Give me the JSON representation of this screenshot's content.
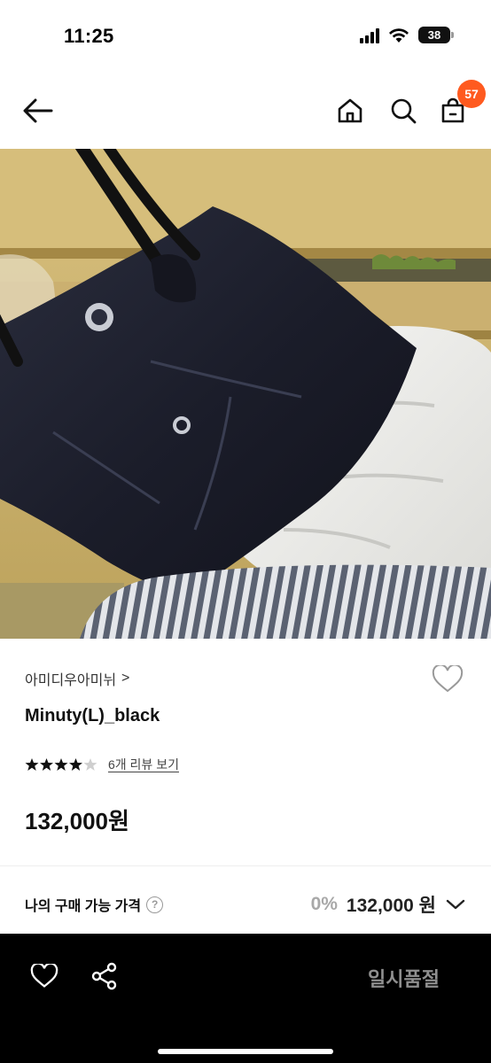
{
  "status": {
    "time": "11:25",
    "battery": "38"
  },
  "nav": {
    "cart_count": "57"
  },
  "product": {
    "brand": "아미디우아미뉘",
    "brand_chevron": ">",
    "name": "Minuty(L)_black",
    "rating": 4.5,
    "review_link": "6개 리뷰 보기",
    "price": "132,000원"
  },
  "my_price": {
    "label": "나의 구매 가능 가격",
    "help": "?",
    "discount": "0%",
    "value": "132,000 원"
  },
  "bottom_bar": {
    "soldout_label": "일시품절"
  },
  "icons": {
    "back": "arrow-left-icon",
    "home": "home-icon",
    "search": "search-icon",
    "cart": "cart-icon",
    "wish": "heart-icon",
    "share": "share-icon",
    "dropdown": "chevron-down-icon"
  },
  "colors": {
    "badge": "#ff5a1f",
    "bottom_bar": "#000000",
    "discount": "#a8a8a8"
  }
}
